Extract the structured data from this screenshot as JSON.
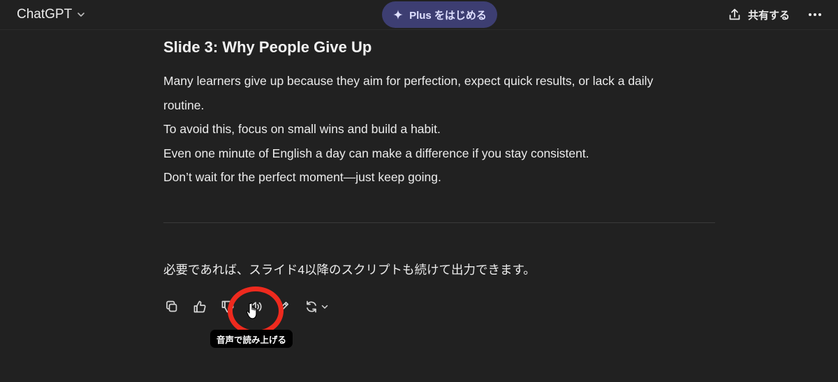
{
  "header": {
    "model_name": "ChatGPT",
    "plus_label": "Plus をはじめる",
    "share_label": "共有する",
    "plus_bg_color": "#3d3e72"
  },
  "message": {
    "heading": "Slide 3: Why People Give Up",
    "lines": [
      "Many learners give up because they aim for perfection, expect quick results, or lack a daily",
      "routine.",
      "To avoid this, focus on small wins and build a habit.",
      "Even one minute of English a day can make a difference if you stay consistent.",
      "Don’t wait for the perfect moment—just keep going."
    ],
    "followup": "必要であれば、スライド4以降のスクリプトも続けて出力できます。"
  },
  "actions": {
    "icons": [
      "copy-icon",
      "thumbs-up-icon",
      "thumbs-down-icon",
      "read-aloud-icon",
      "edit-icon",
      "regenerate-icon"
    ],
    "tooltip": "音声で読み上げる",
    "highlight_color": "#ee2a1e"
  }
}
